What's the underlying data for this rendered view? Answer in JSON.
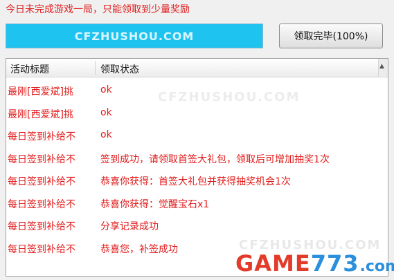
{
  "notice": "今日未完成游戏一局，只能领取到少量奖励",
  "progress": {
    "watermark": "CFZHUSHOU.COM",
    "percent": 100
  },
  "done_button": "领取完毕(100%)",
  "list": {
    "headers": [
      "活动标题",
      "领取状态"
    ],
    "rows": [
      {
        "title": "最刚[西爱斌]挑",
        "status": "ok"
      },
      {
        "title": "最刚[西爱斌]挑",
        "status": "ok"
      },
      {
        "title": "每日签到补给不",
        "status": "ok"
      },
      {
        "title": "每日签到补给不",
        "status": "签到成功，请领取首签大礼包，领取后可增加抽奖1次"
      },
      {
        "title": "每日签到补给不",
        "status": "恭喜你获得：首签大礼包并获得抽奖机会1次"
      },
      {
        "title": "每日签到补给不",
        "status": "恭喜你获得：觉醒宝石x1"
      },
      {
        "title": "每日签到补给不",
        "status": "分享记录成功"
      },
      {
        "title": "每日签到补给不",
        "status": "恭喜您，补签成功"
      }
    ]
  },
  "watermarks": {
    "middle": "CFZHUSHOU.COM",
    "lower": "CFZHUSHOU.COM"
  },
  "logo": {
    "part1": "GAME",
    "part2": "773",
    "domain": ".com"
  },
  "colors": {
    "accent_red": "#e11b1b",
    "progress_cyan": "#1ec3ef",
    "logo_red": "#e23b2a",
    "logo_blue": "#2a8fdc"
  }
}
